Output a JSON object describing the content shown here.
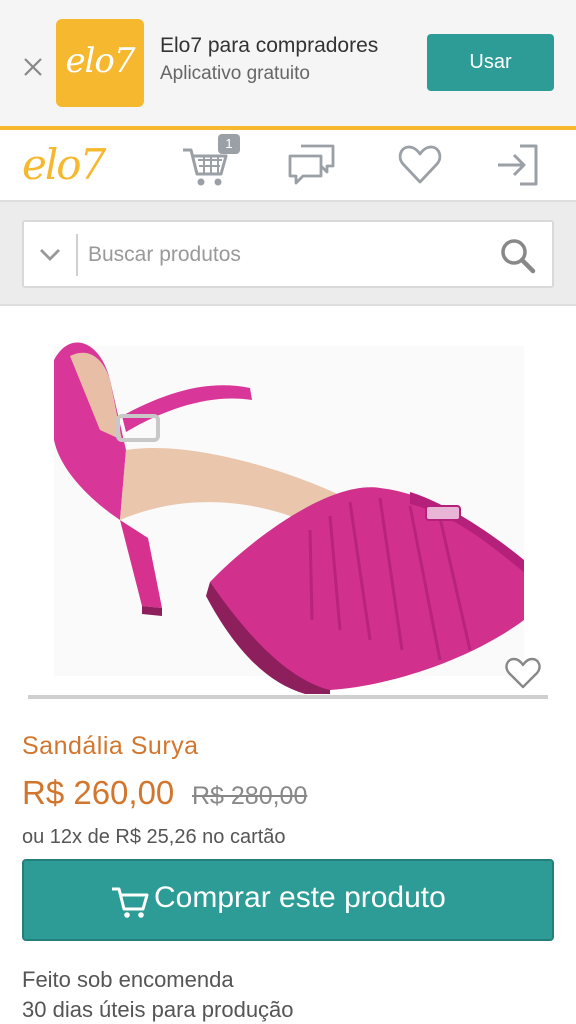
{
  "app_banner": {
    "logo_text": "elo7",
    "title": "Elo7 para compradores",
    "subtitle": "Aplicativo gratuito",
    "button_label": "Usar",
    "close_icon": "close-icon"
  },
  "header": {
    "logo_text": "elo7",
    "cart_count": "1",
    "icons": [
      "cart-icon",
      "chat-icon",
      "heart-icon",
      "login-icon"
    ]
  },
  "search": {
    "placeholder": "Buscar produtos"
  },
  "product": {
    "name": "Sandália Surya",
    "price": "R$ 260,00",
    "old_price": "R$ 280,00",
    "installments": "ou 12x de R$ 25,26 no cartão",
    "buy_label": "Comprar este produto",
    "made_to_order": "Feito sob encomenda",
    "production_time": "30 dias úteis para produção"
  },
  "colors": {
    "brand_yellow": "#f5b82e",
    "accent_teal": "#2d9c96",
    "price_orange": "#d2762e"
  }
}
